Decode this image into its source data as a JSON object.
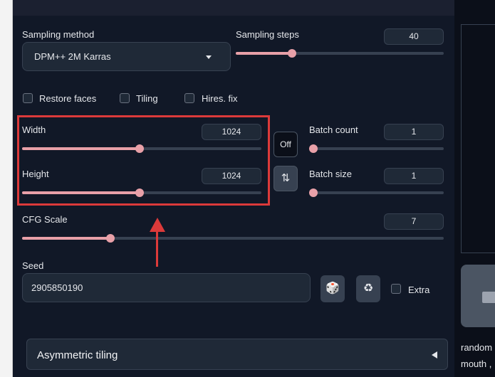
{
  "sampling": {
    "method_label": "Sampling method",
    "method_value": "DPM++ 2M Karras",
    "steps_label": "Sampling steps",
    "steps_value": "40",
    "steps_fraction": 0.27
  },
  "options": {
    "restore_faces": "Restore faces",
    "tiling": "Tiling",
    "hires_fix": "Hires. fix"
  },
  "size": {
    "width_label": "Width",
    "width_value": "1024",
    "width_fraction": 0.49,
    "height_label": "Height",
    "height_value": "1024",
    "height_fraction": 0.49,
    "off_label": "Off",
    "swap_glyph": "⇅"
  },
  "batch": {
    "count_label": "Batch count",
    "count_value": "1",
    "count_fraction": 0.0,
    "size_label": "Batch size",
    "size_value": "1",
    "size_fraction": 0.0
  },
  "cfg": {
    "label": "CFG Scale",
    "value": "7",
    "fraction": 0.21
  },
  "seed": {
    "label": "Seed",
    "value": "2905850190",
    "dice_glyph": "🎲",
    "recycle_glyph": "♻",
    "extra_label": "Extra"
  },
  "accordion": {
    "title": "Asymmetric tiling"
  },
  "right_caption": {
    "line1": "random",
    "line2": "mouth ,"
  },
  "colors": {
    "accent": "#e8a0a8",
    "highlight": "#dc3a3a",
    "background": "#111827"
  }
}
